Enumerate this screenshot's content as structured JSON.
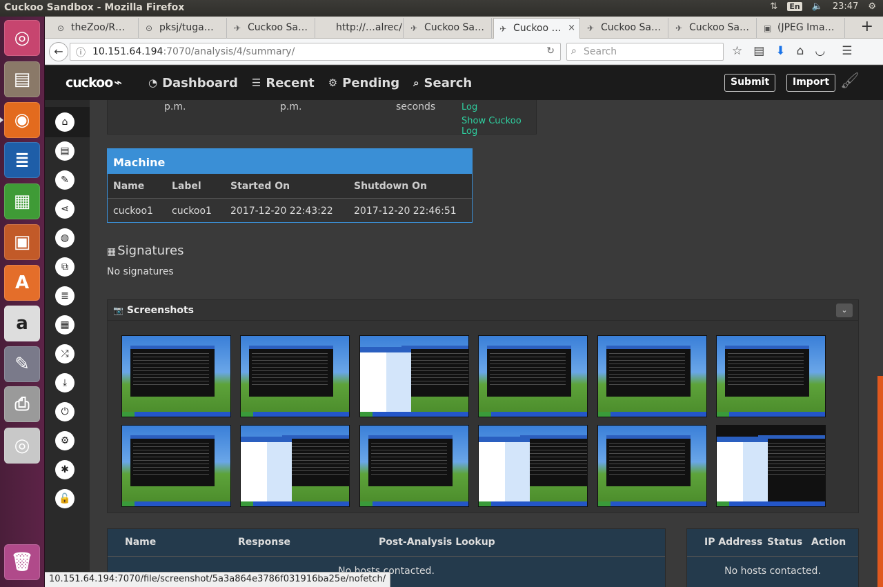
{
  "os": {
    "window_title": "Cuckoo Sandbox - Mozilla Firefox",
    "lang": "En",
    "clock": "23:47"
  },
  "launcher": [
    {
      "name": "ubuntu-dash-icon",
      "color": "#c7456f",
      "glyph": "◎"
    },
    {
      "name": "files-icon",
      "color": "#8a7968",
      "glyph": "▤"
    },
    {
      "name": "firefox-icon",
      "color": "#e36b1e",
      "glyph": "◉"
    },
    {
      "name": "writer-icon",
      "color": "#1e5ea8",
      "glyph": "≣"
    },
    {
      "name": "calc-icon",
      "color": "#3f9b36",
      "glyph": "▦"
    },
    {
      "name": "impress-icon",
      "color": "#c25a28",
      "glyph": "▣"
    },
    {
      "name": "software-center-icon",
      "color": "#e46e2a",
      "glyph": "A"
    },
    {
      "name": "amazon-icon",
      "color": "#dddddd",
      "glyph": "a"
    },
    {
      "name": "settings-icon",
      "color": "#7a7a8a",
      "glyph": "✎"
    },
    {
      "name": "printer-icon",
      "color": "#9a9a9a",
      "glyph": "⎙"
    },
    {
      "name": "dvd-icon",
      "color": "#c8c8c8",
      "glyph": "◎"
    },
    {
      "name": "trash-icon",
      "color": "#b04a8a",
      "glyph": "🗑"
    }
  ],
  "tabs": [
    {
      "label": "theZoo/R…",
      "icon": "⊙"
    },
    {
      "label": "pksj/tuga…",
      "icon": "⊙"
    },
    {
      "label": "Cuckoo Sa…",
      "icon": "✈"
    },
    {
      "label": "http://…alrec/",
      "icon": ""
    },
    {
      "label": "Cuckoo Sa…",
      "icon": "✈"
    },
    {
      "label": "Cuckoo …",
      "icon": "✈",
      "active": true
    },
    {
      "label": "Cuckoo Sa…",
      "icon": "✈"
    },
    {
      "label": "Cuckoo Sa…",
      "icon": "✈"
    },
    {
      "label": "(JPEG Ima…",
      "icon": "▣"
    }
  ],
  "nav": {
    "url_host": "10.151.64.194",
    "url_rest": ":7070/analysis/4/summary/",
    "search_placeholder": "Search"
  },
  "header": {
    "brand": "cuckoo",
    "links": [
      {
        "label": "Dashboard",
        "icon": "◔"
      },
      {
        "label": "Recent",
        "icon": "☰"
      },
      {
        "label": "Pending",
        "icon": "⚙"
      },
      {
        "label": "Search",
        "icon": "⌕"
      }
    ],
    "submit": "Submit",
    "import": "Import"
  },
  "sidenav": [
    "⌂",
    "▤",
    "✎",
    "⋖",
    "◍",
    "⧉",
    "≣",
    "▦",
    "⤮",
    "⤓",
    "⏻",
    "⚙",
    "✱",
    "🔓"
  ],
  "info_panel": {
    "started": "p.m.",
    "completed": "p.m.",
    "duration": "seconds",
    "log": "Log",
    "cuckoo_log": "Show Cuckoo Log"
  },
  "machine": {
    "title": "Machine",
    "headers": [
      "Name",
      "Label",
      "Started On",
      "Shutdown On"
    ],
    "row": [
      "cuckoo1",
      "cuckoo1",
      "2017-12-20 22:43:22",
      "2017-12-20 22:46:51"
    ]
  },
  "signatures": {
    "title": "Signatures",
    "empty": "No signatures"
  },
  "screenshots": {
    "title": "Screenshots",
    "kinds": [
      "console",
      "console",
      "menu",
      "console",
      "console",
      "console",
      "console",
      "menu",
      "console",
      "menu",
      "console",
      "dark"
    ]
  },
  "hosts": {
    "headers": [
      "Name",
      "Response",
      "Post-Analysis Lookup"
    ],
    "empty": "No hosts contacted."
  },
  "ip": {
    "headers": [
      "IP Address",
      "Status",
      "Action"
    ],
    "empty": "No hosts contacted."
  },
  "status_url": "10.151.64.194:7070/file/screenshot/5a3a864e3786f031916ba25e/nofetch/"
}
